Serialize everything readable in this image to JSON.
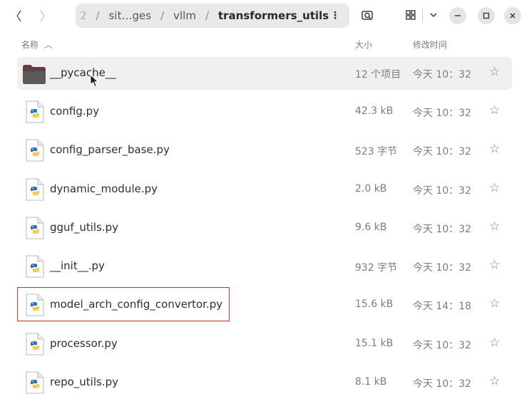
{
  "toolbar": {
    "back_glyph": "〈",
    "forward_glyph": "〉",
    "path": [
      {
        "label": "2"
      },
      {
        "label": "sit…ges"
      },
      {
        "label": "vllm"
      },
      {
        "label": "transformers_utils"
      }
    ],
    "path_separator": "/",
    "path_menu_glyph": "⋮",
    "icons": [
      "back-icon",
      "forward-icon",
      "path-menu-icon",
      "search-icon",
      "grid-view-icon",
      "view-options-chevron-icon",
      "minimize-icon",
      "maximize-icon",
      "close-icon"
    ]
  },
  "columns": {
    "name": "名称",
    "sort_indicator": "︿",
    "size": "大小",
    "modified": "修改时间"
  },
  "files": [
    {
      "name": "__pycache__",
      "size": "12 个项目",
      "modified": "今天 10：32",
      "type": "folder"
    },
    {
      "name": "config.py",
      "size": "42.3 kB",
      "modified": "今天 10：32",
      "type": "python"
    },
    {
      "name": "config_parser_base.py",
      "size": "523 字节",
      "modified": "今天 10：32",
      "type": "python"
    },
    {
      "name": "dynamic_module.py",
      "size": "2.0 kB",
      "modified": "今天 10：32",
      "type": "python"
    },
    {
      "name": "gguf_utils.py",
      "size": "9.6 kB",
      "modified": "今天 10：32",
      "type": "python"
    },
    {
      "name": "__init__.py",
      "size": "932 字节",
      "modified": "今天 10：32",
      "type": "python"
    },
    {
      "name": "model_arch_config_convertor.py",
      "size": "15.6 kB",
      "modified": "今天 14：18",
      "type": "python"
    },
    {
      "name": "processor.py",
      "size": "15.1 kB",
      "modified": "今天 10：32",
      "type": "python"
    },
    {
      "name": "repo_utils.py",
      "size": "8.1 kB",
      "modified": "今天 10：32",
      "type": "python"
    }
  ],
  "star_glyph": "☆",
  "colors": {
    "folder": "#6b3a3f",
    "python_blue": "#3572a5",
    "python_yellow": "#f2c94c",
    "highlight_border": "#c0392b",
    "pathbar_bg": "#e9e9e9"
  }
}
